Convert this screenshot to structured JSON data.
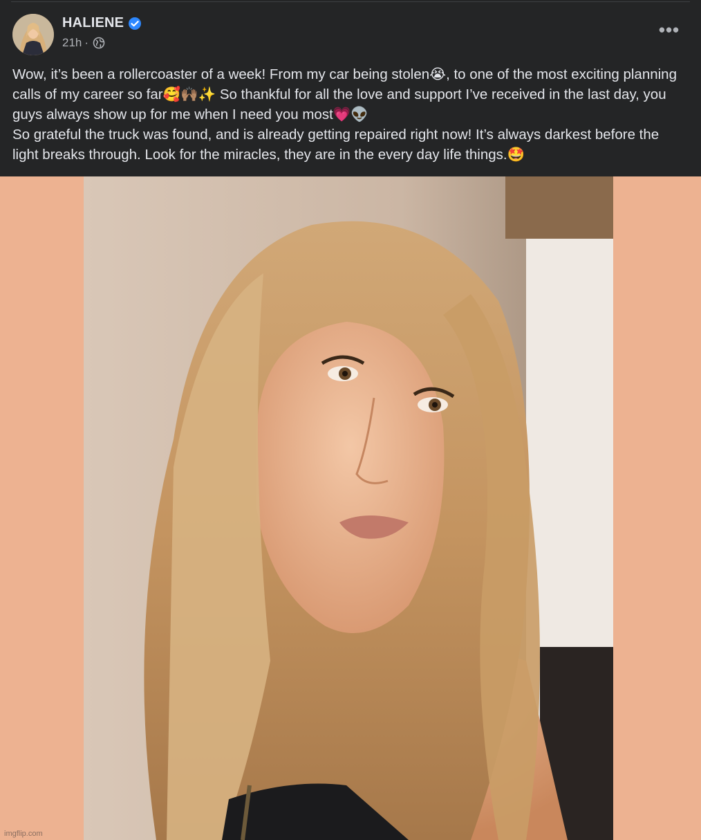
{
  "post": {
    "author": "HALIENE",
    "verified_icon": "verified-badge-icon",
    "time": "21h",
    "separator": "·",
    "audience_icon": "globe-icon",
    "more_label": "•••",
    "text_lines": [
      "Wow, it’s been a rollercoaster of a week! From my car being stolen😭, to one of the most exciting planning calls of my career so far🥰🙌🏽✨ So thankful for all the love and support I’ve received in the last day, you guys always show up for me when I need you most💗👽",
      "So grateful the truck was found, and is already getting repaired right now! It’s always darkest before the light breaks through. Look for the miracles, they are in the every day life things.🤩"
    ]
  },
  "media": {
    "background_color": "#edb291",
    "watermark": "imgflip.com"
  },
  "colors": {
    "post_background": "#242526",
    "primary_text": "#e4e6eb",
    "secondary_text": "#b0b3b8",
    "verified_blue": "#2d88ff"
  }
}
